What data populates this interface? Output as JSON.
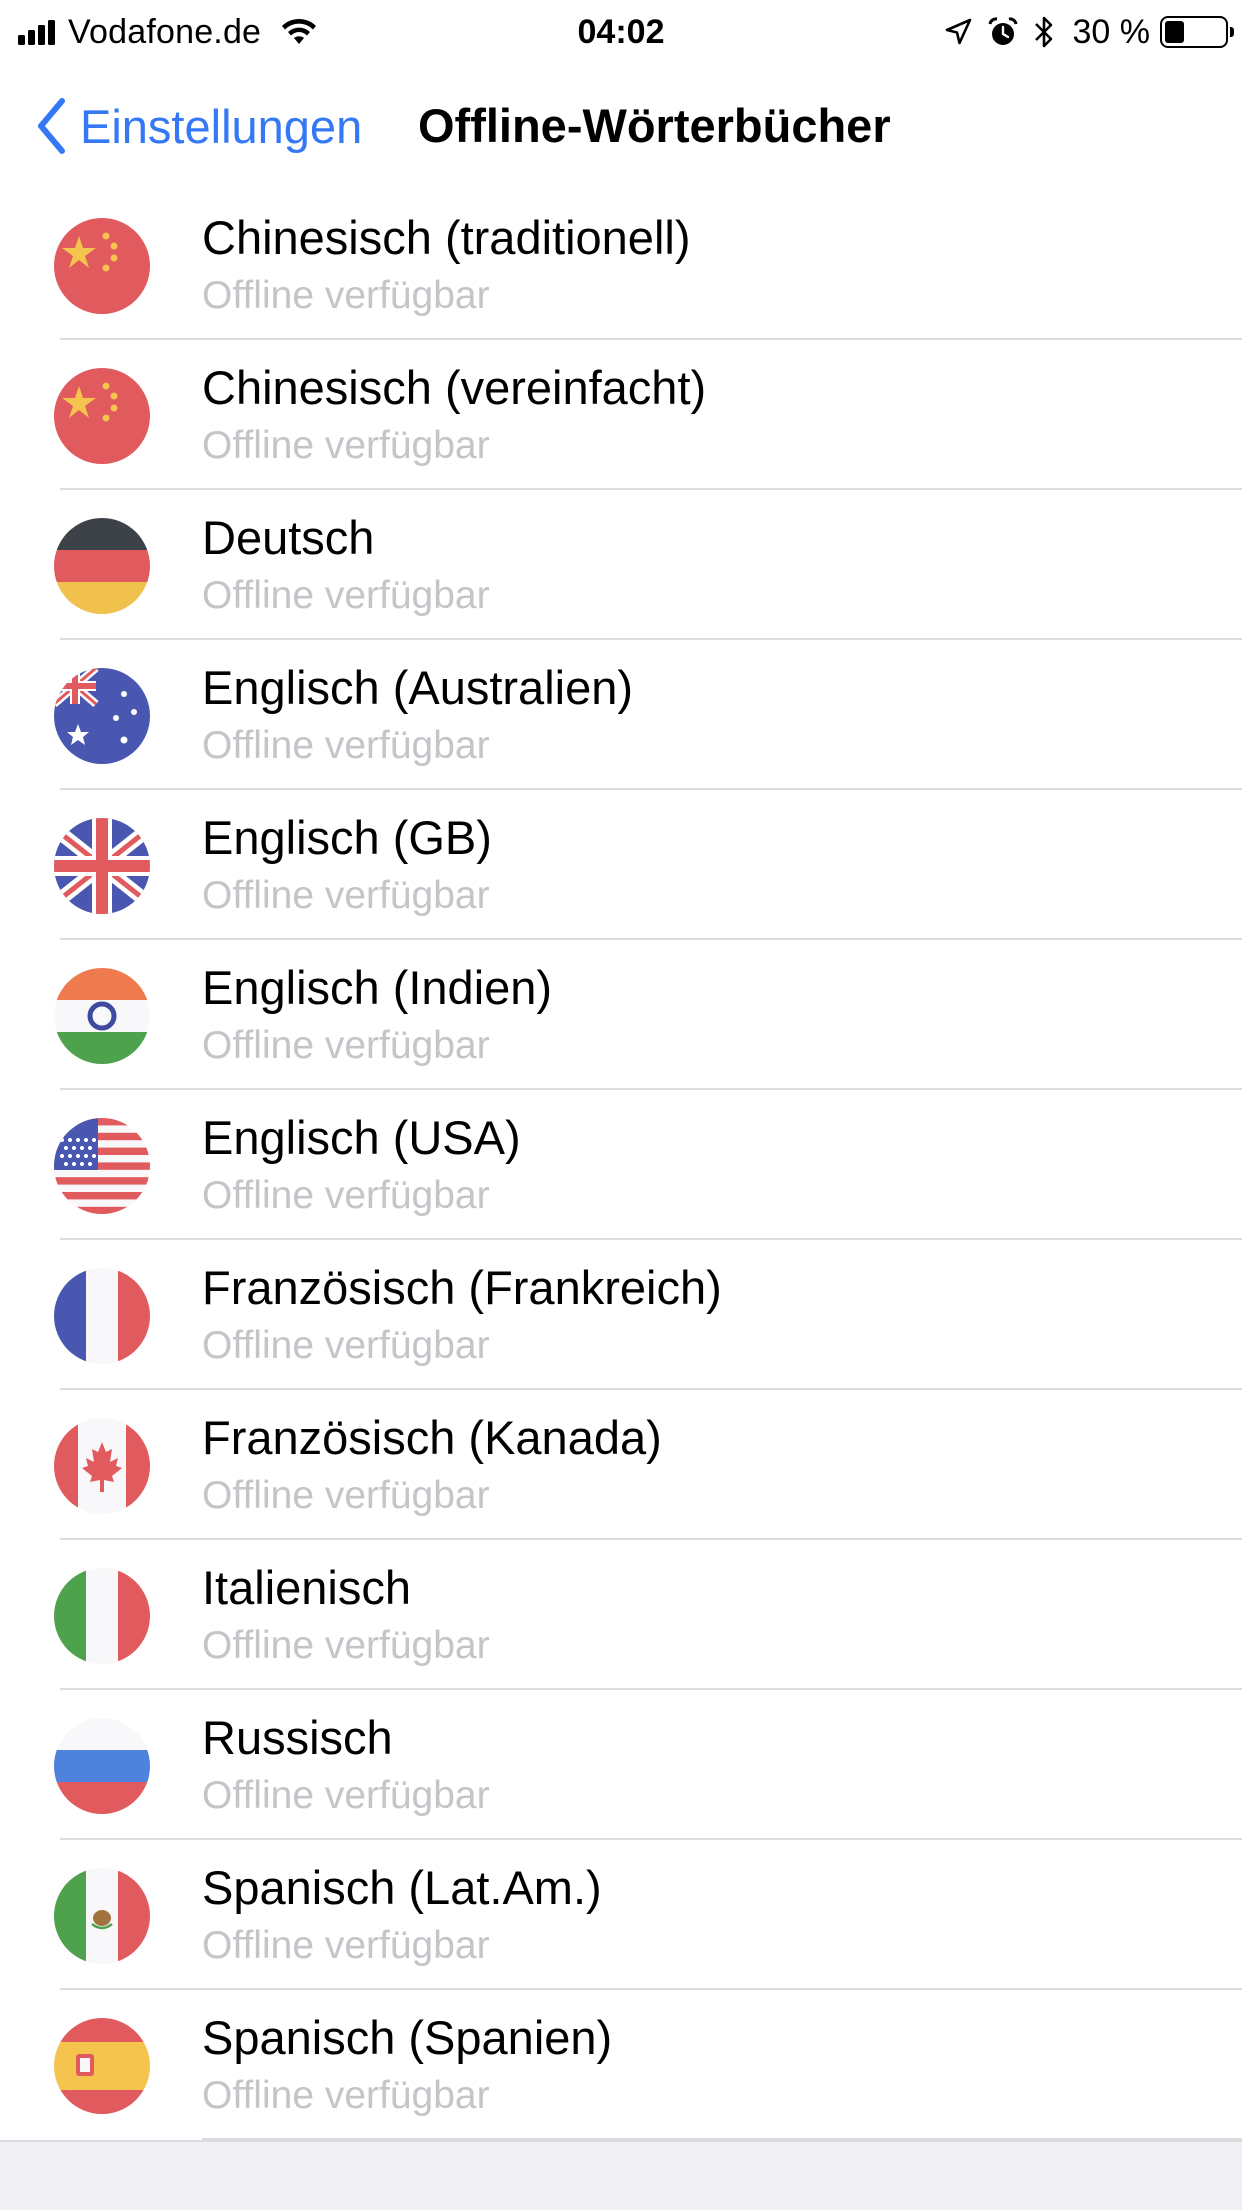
{
  "status_bar": {
    "carrier": "Vodafone.de",
    "time": "04:02",
    "battery_percent": "30 %"
  },
  "nav": {
    "back_label": "Einstellungen",
    "title": "Offline-Wörterbücher"
  },
  "languages": [
    {
      "name": "Chinesisch (traditionell)",
      "status": "Offline verfügbar",
      "flag": "china-flag-icon"
    },
    {
      "name": "Chinesisch (vereinfacht)",
      "status": "Offline verfügbar",
      "flag": "china-flag-icon"
    },
    {
      "name": "Deutsch",
      "status": "Offline verfügbar",
      "flag": "germany-flag-icon"
    },
    {
      "name": "Englisch (Australien)",
      "status": "Offline verfügbar",
      "flag": "australia-flag-icon"
    },
    {
      "name": "Englisch (GB)",
      "status": "Offline verfügbar",
      "flag": "uk-flag-icon"
    },
    {
      "name": "Englisch (Indien)",
      "status": "Offline verfügbar",
      "flag": "india-flag-icon"
    },
    {
      "name": "Englisch (USA)",
      "status": "Offline verfügbar",
      "flag": "usa-flag-icon"
    },
    {
      "name": "Französisch (Frankreich)",
      "status": "Offline verfügbar",
      "flag": "france-flag-icon"
    },
    {
      "name": "Französisch (Kanada)",
      "status": "Offline verfügbar",
      "flag": "canada-flag-icon"
    },
    {
      "name": "Italienisch",
      "status": "Offline verfügbar",
      "flag": "italy-flag-icon"
    },
    {
      "name": "Russisch",
      "status": "Offline verfügbar",
      "flag": "russia-flag-icon"
    },
    {
      "name": "Spanisch (Lat.Am.)",
      "status": "Offline verfügbar",
      "flag": "mexico-flag-icon"
    },
    {
      "name": "Spanisch (Spanien)",
      "status": "Offline verfügbar",
      "flag": "spain-flag-icon"
    }
  ],
  "colors": {
    "accent": "#3478f6",
    "subtitle": "#c4c4c9",
    "separator": "#dcdce0"
  }
}
